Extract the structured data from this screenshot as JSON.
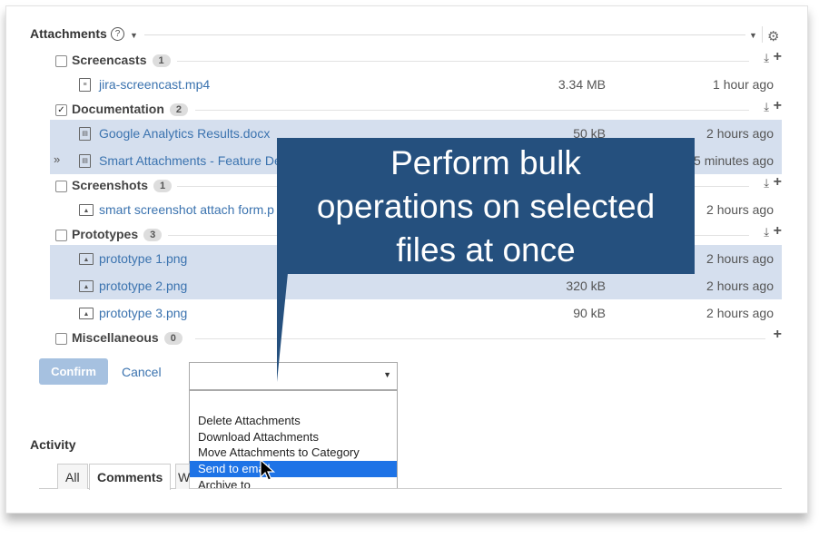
{
  "header": {
    "title": "Attachments",
    "help_icon": "?"
  },
  "categories": [
    {
      "name": "Screencasts",
      "count": "1",
      "checked": false
    },
    {
      "name": "Documentation",
      "count": "2",
      "checked": true
    },
    {
      "name": "Screenshots",
      "count": "1",
      "checked": false
    },
    {
      "name": "Prototypes",
      "count": "3",
      "checked": false
    },
    {
      "name": "Miscellaneous",
      "count": "0",
      "checked": false
    }
  ],
  "files": [
    {
      "name": "jira-screencast.mp4",
      "size": "3.34 MB",
      "time": "1 hour ago",
      "icon": "document-icon",
      "selected": false
    },
    {
      "name": "Google Analytics Results.docx",
      "size": "50 kB",
      "time": "2 hours ago",
      "icon": "doc-icon",
      "selected": true
    },
    {
      "name": "Smart Attachments - Feature De",
      "size": "",
      "time": "5 minutes ago",
      "icon": "doc-icon",
      "selected": true
    },
    {
      "name": "smart screenshot attach form.p",
      "size": "",
      "time": "2 hours ago",
      "icon": "image-icon",
      "selected": false
    },
    {
      "name": "prototype 1.png",
      "size": "",
      "time": "2 hours ago",
      "icon": "image-icon",
      "selected": true
    },
    {
      "name": "prototype 2.png",
      "size": "320 kB",
      "time": "2 hours ago",
      "icon": "image-icon",
      "selected": true
    },
    {
      "name": "prototype 3.png",
      "size": "90 kB",
      "time": "2 hours ago",
      "icon": "image-icon",
      "selected": false
    }
  ],
  "actions": {
    "confirm": "Confirm",
    "cancel": "Cancel",
    "select_value": ""
  },
  "dropdown_options": [
    "Delete Attachments",
    "Download Attachments",
    "Move Attachments to Category",
    "Send to email",
    "Archive to"
  ],
  "dropdown_highlighted": "Send to email",
  "activity": {
    "title": "Activity",
    "tabs": [
      "All",
      "Comments",
      "W"
    ]
  },
  "callout": {
    "line1": "Perform bulk",
    "line2": "operations on selected",
    "line3": "files at once"
  },
  "colors": {
    "accent": "#3b73af",
    "selection": "#d5dfee",
    "callout": "#25507e",
    "highlight": "#1e73e6"
  }
}
